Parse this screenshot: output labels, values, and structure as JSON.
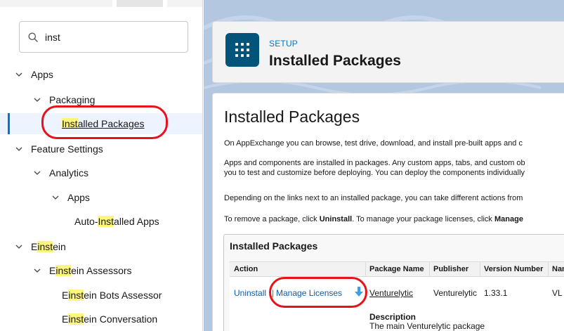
{
  "sidebar": {
    "search": {
      "value": "inst",
      "placeholder": ""
    },
    "tree": [
      {
        "pre": "",
        "hl": "",
        "post": "Apps",
        "level": 0
      },
      {
        "pre": "",
        "hl": "",
        "post": "Packaging",
        "level": 1
      },
      {
        "pre": "",
        "hl": "Inst",
        "post": "alled Packages",
        "level": 2,
        "selected": true
      },
      {
        "pre": "",
        "hl": "",
        "post": "Feature Settings",
        "level": 0
      },
      {
        "pre": "",
        "hl": "",
        "post": "Analytics",
        "level": 1
      },
      {
        "pre": "",
        "hl": "",
        "post": "Apps",
        "level": 2
      },
      {
        "pre": "Auto-",
        "hl": "Inst",
        "post": "alled Apps",
        "level": 3
      },
      {
        "pre": "E",
        "hl": "inst",
        "post": "ein",
        "level": 0
      },
      {
        "pre": "E",
        "hl": "inst",
        "post": "ein Assessors",
        "level": 1
      },
      {
        "pre": "E",
        "hl": "inst",
        "post": "ein Bots Assessor",
        "level": 2
      },
      {
        "pre": "E",
        "hl": "inst",
        "post": "ein Conversation",
        "level": 2
      }
    ]
  },
  "header": {
    "kicker": "SETUP",
    "title": "Installed Packages"
  },
  "content": {
    "heading": "Installed Packages",
    "p1": "On AppExchange you can browse, test drive, download, and install pre-built apps and c",
    "p2_line1": "Apps and components are installed in packages. Any custom apps, tabs, and custom ob",
    "p2_line2": "you to test and customize before deploying. You can deploy the components individually",
    "p3": "Depending on the links next to an installed package, you can take different actions from",
    "p4_a": "To remove a package, click ",
    "p4_b": "Uninstall",
    "p4_c": ". To manage your package licenses, click ",
    "p4_d": "Manage"
  },
  "packages": {
    "panel_title": "Installed Packages",
    "columns": [
      "Action",
      "Package Name",
      "Publisher",
      "Version Number",
      "Nam"
    ],
    "row": {
      "uninstall": "Uninstall",
      "separator": "|",
      "manage_licenses": "Manage Licenses",
      "package_name": "Venturelytic",
      "publisher": "Venturelytic",
      "version": "1.33.1",
      "namespace": "VL",
      "description_label": "Description",
      "description": "The main Venturelytic package"
    }
  },
  "colors": {
    "accent": "#0176d3",
    "highlight": "#fdf67a",
    "annotation": "#e8121b",
    "icon_bg": "#02547a"
  }
}
